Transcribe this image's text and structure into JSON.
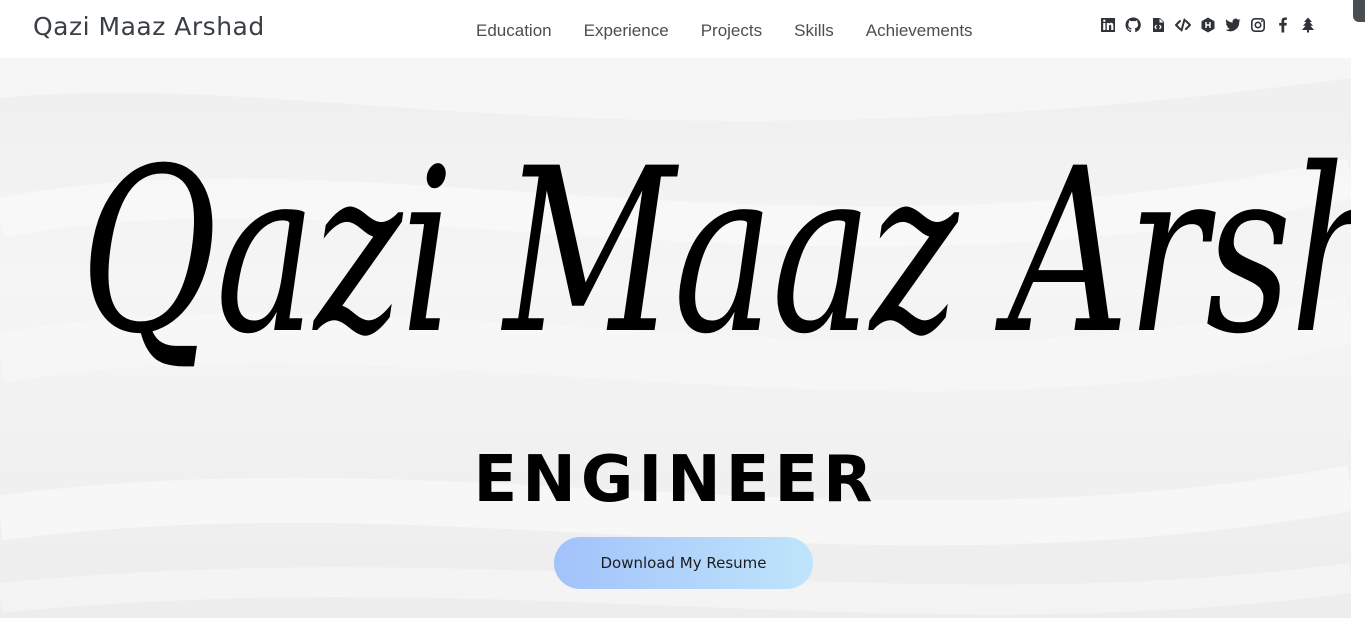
{
  "header": {
    "brand": "Qazi Maaz Arshad",
    "nav": [
      {
        "label": "Education"
      },
      {
        "label": "Experience"
      },
      {
        "label": "Projects"
      },
      {
        "label": "Skills"
      },
      {
        "label": "Achievements"
      }
    ],
    "socials": [
      "linkedin-icon",
      "github-icon",
      "file-code-icon",
      "code-icon",
      "hackerrank-icon",
      "twitter-icon",
      "instagram-icon",
      "facebook-icon",
      "linktree-icon"
    ]
  },
  "hero": {
    "signature": "Qazi Maaz Arshad",
    "role": "ENGINEER",
    "resume_button": "Download My Resume"
  },
  "colors": {
    "text_dark": "#3a3f45",
    "button_gradient_start": "#a2c2fb",
    "button_gradient_end": "#bfe5fb"
  }
}
